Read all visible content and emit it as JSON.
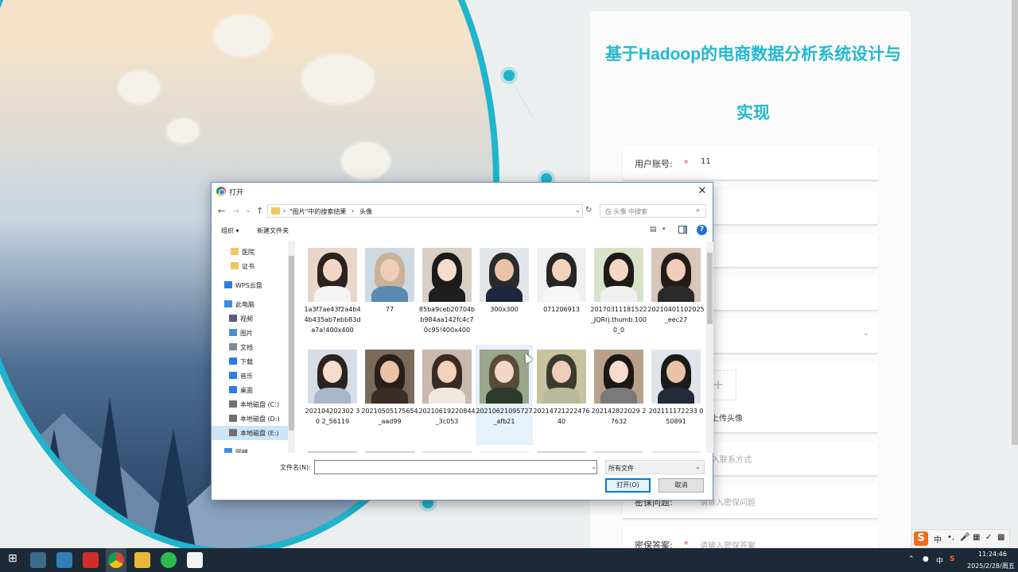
{
  "form": {
    "title": "基于Hadoop的电商数据分析系统设计与实现",
    "rows": [
      {
        "label": "用户账号:",
        "value": "11",
        "placeholder": ""
      },
      {
        "label": "",
        "value": "",
        "placeholder": ""
      },
      {
        "label": "",
        "value": "",
        "placeholder": ""
      },
      {
        "label": "",
        "value": "",
        "placeholder": ""
      },
      {
        "label": "",
        "value": "",
        "placeholder": ""
      },
      {
        "label": "",
        "value": "",
        "placeholder": "入联系方式"
      },
      {
        "label": "密保问题:",
        "value": "",
        "placeholder": "请输入密保问题"
      },
      {
        "label": "密保答案:",
        "value": "",
        "placeholder": "请输入密保答案"
      }
    ],
    "required_mark": "*",
    "upload_plus": "+",
    "upload_label": "上传头像"
  },
  "dialog": {
    "title": "打开",
    "close": "✕",
    "breadcrumb": [
      "\"图片\"中的搜索结果",
      "头像"
    ],
    "search_placeholder": "在 头像 中搜索",
    "organize": "组织 ▾",
    "new_folder": "新建文件夹",
    "help": "?",
    "nav_items": [
      {
        "label": "医院",
        "icon": "folder-icon"
      },
      {
        "label": "证书",
        "icon": "folder-icon"
      },
      {
        "label": "WPS云盘",
        "icon": "cloud-icon"
      },
      {
        "label": "此电脑",
        "icon": "computer-icon"
      },
      {
        "label": "视频",
        "icon": "video-icon"
      },
      {
        "label": "图片",
        "icon": "picture-icon"
      },
      {
        "label": "文档",
        "icon": "document-icon"
      },
      {
        "label": "下载",
        "icon": "download-icon"
      },
      {
        "label": "音乐",
        "icon": "music-icon"
      },
      {
        "label": "桌面",
        "icon": "desktop-icon"
      },
      {
        "label": "本地磁盘 (C:)",
        "icon": "drive-icon"
      },
      {
        "label": "本地磁盘 (D:)",
        "icon": "drive-icon"
      },
      {
        "label": "本地磁盘 (E:)",
        "icon": "drive-icon"
      },
      {
        "label": "网络",
        "icon": "network-icon"
      }
    ],
    "files": [
      {
        "name": "1a3f7ae43f2a4b44b435ab7ebb83da7a!400x400"
      },
      {
        "name": "77"
      },
      {
        "name": "85ba9ceb20704bb984aa142fc4c70c95!400x400"
      },
      {
        "name": "300x300"
      },
      {
        "name": "071206913"
      },
      {
        "name": "20170311181522_JQRrj.thumb.1000_0"
      },
      {
        "name": "20210401102025_eec27"
      },
      {
        "name": "202104202302 30 2_56119"
      },
      {
        "name": "20210505175654_aad99"
      },
      {
        "name": "20210619220844_3c053"
      },
      {
        "name": "20210621095727_afb21"
      },
      {
        "name": "20214721222476 40"
      },
      {
        "name": "202142822029 27632"
      },
      {
        "name": "202111172233 050891"
      },
      {
        "name": ""
      },
      {
        "name": ""
      },
      {
        "name": ""
      },
      {
        "name": ""
      },
      {
        "name": ""
      },
      {
        "name": ""
      },
      {
        "name": ""
      }
    ],
    "filename_label": "文件名(N):",
    "filename_value": "",
    "filter_value": "所有文件",
    "open_button": "打开(O)",
    "cancel_button": "取消"
  },
  "tray": {
    "ime_lang": "中",
    "time": "11:24:46",
    "date": "2025/2/28/周五"
  },
  "colors": {
    "accent": "#1fb5cc",
    "title": "#22b8cf",
    "required": "#e33333",
    "selection": "#cce4f7"
  }
}
